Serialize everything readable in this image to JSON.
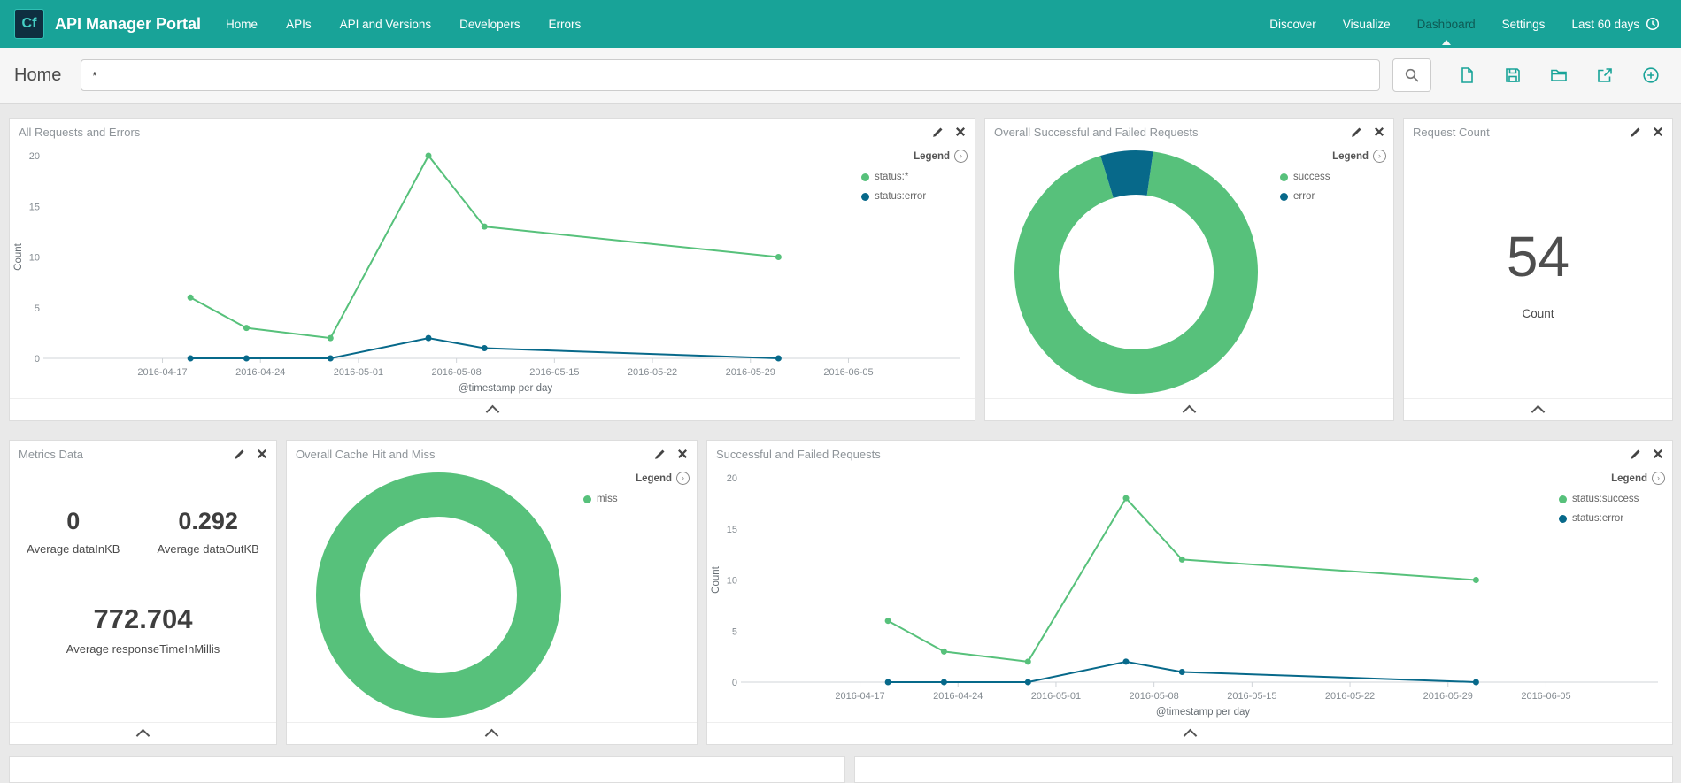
{
  "navbar": {
    "logo": "Cf",
    "title": "API Manager Portal",
    "links": [
      "Home",
      "APIs",
      "API and Versions",
      "Developers",
      "Errors"
    ],
    "right_links": [
      "Discover",
      "Visualize",
      "Dashboard",
      "Settings"
    ],
    "active_right_link": "Dashboard",
    "time_filter": "Last 60 days"
  },
  "toolbar": {
    "breadcrumb": "Home",
    "search_value": "*",
    "icons": [
      "search-icon",
      "new-document-icon",
      "save-icon",
      "open-folder-icon",
      "share-icon",
      "add-panel-icon"
    ]
  },
  "colors": {
    "accent": "#18A398",
    "series_green": "#57C17B",
    "series_blue": "#07698A",
    "panel_title": "#8E9499",
    "page_background": "#E9E9E9"
  },
  "panels": {
    "all_requests": {
      "title": "All Requests and Errors"
    },
    "overall_success_failed": {
      "title": "Overall Successful and Failed Requests"
    },
    "request_count": {
      "title": "Request Count",
      "value": "54",
      "label": "Count"
    },
    "metrics": {
      "title": "Metrics Data",
      "items": [
        {
          "value": "0",
          "label": "Average dataInKB"
        },
        {
          "value": "0.292",
          "label": "Average dataOutKB"
        },
        {
          "value": "772.704",
          "label": "Average responseTimeInMillis"
        }
      ]
    },
    "cache": {
      "title": "Overall Cache Hit and Miss"
    },
    "success_failed": {
      "title": "Successful and Failed Requests"
    }
  },
  "chart_data": [
    {
      "panel": "All Requests and Errors",
      "type": "line",
      "legend_label": "Legend",
      "xlabel": "@timestamp per day",
      "ylabel": "Count",
      "ylim": [
        0,
        20
      ],
      "yticks": [
        0,
        5,
        10,
        15,
        20
      ],
      "xticks": [
        "2016-04-17",
        "2016-04-24",
        "2016-05-01",
        "2016-05-08",
        "2016-05-15",
        "2016-05-22",
        "2016-05-29",
        "2016-06-05"
      ],
      "xtick_days": [
        0,
        7,
        14,
        21,
        28,
        35,
        42,
        49
      ],
      "xdomain": [
        -8,
        57
      ],
      "series": [
        {
          "name": "status:*",
          "color": "#57C17B",
          "points": [
            [
              2,
              6
            ],
            [
              6,
              3
            ],
            [
              12,
              2
            ],
            [
              19,
              20
            ],
            [
              23,
              13
            ],
            [
              44,
              10
            ]
          ]
        },
        {
          "name": "status:error",
          "color": "#07698A",
          "points": [
            [
              2,
              0
            ],
            [
              6,
              0
            ],
            [
              12,
              0
            ],
            [
              19,
              2
            ],
            [
              23,
              1
            ],
            [
              44,
              0
            ]
          ]
        }
      ]
    },
    {
      "panel": "Overall Successful and Failed Requests",
      "type": "donut",
      "legend_label": "Legend",
      "start_deg": -82,
      "slices": [
        {
          "name": "success",
          "color": "#57C17B",
          "value": 93
        },
        {
          "name": "error",
          "color": "#07698A",
          "value": 7
        }
      ]
    },
    {
      "panel": "Overall Cache Hit and Miss",
      "type": "donut",
      "legend_label": "Legend",
      "start_deg": -90,
      "slices": [
        {
          "name": "miss",
          "color": "#57C17B",
          "value": 100
        }
      ]
    },
    {
      "panel": "Successful and Failed Requests",
      "type": "line",
      "legend_label": "Legend",
      "xlabel": "@timestamp per day",
      "ylabel": "Count",
      "ylim": [
        0,
        20
      ],
      "yticks": [
        0,
        5,
        10,
        15,
        20
      ],
      "xticks": [
        "2016-04-17",
        "2016-04-24",
        "2016-05-01",
        "2016-05-08",
        "2016-05-15",
        "2016-05-22",
        "2016-05-29",
        "2016-06-05"
      ],
      "xtick_days": [
        0,
        7,
        14,
        21,
        28,
        35,
        42,
        49
      ],
      "xdomain": [
        -8,
        57
      ],
      "series": [
        {
          "name": "status:success",
          "color": "#57C17B",
          "points": [
            [
              2,
              6
            ],
            [
              6,
              3
            ],
            [
              12,
              2
            ],
            [
              19,
              18
            ],
            [
              23,
              12
            ],
            [
              44,
              10
            ]
          ]
        },
        {
          "name": "status:error",
          "color": "#07698A",
          "points": [
            [
              2,
              0
            ],
            [
              6,
              0
            ],
            [
              12,
              0
            ],
            [
              19,
              2
            ],
            [
              23,
              1
            ],
            [
              44,
              0
            ]
          ]
        }
      ]
    }
  ]
}
